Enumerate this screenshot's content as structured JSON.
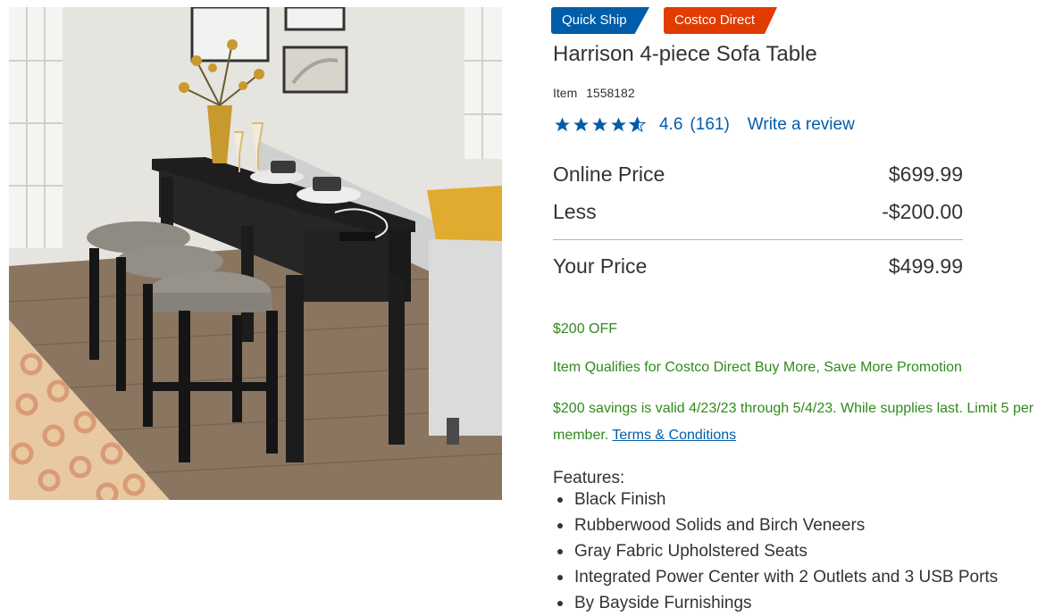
{
  "badges": {
    "quick_ship": "Quick Ship",
    "costco_direct": "Costco Direct"
  },
  "product": {
    "title": "Harrison 4-piece Sofa Table",
    "item_label": "Item",
    "item_number": "1558182",
    "image_icon": "sofa-table-photo"
  },
  "rating": {
    "value": "4.6",
    "stars_fraction": 0.92,
    "count": "(161)",
    "write_review": "Write a review"
  },
  "pricing": {
    "online_label": "Online Price",
    "online_value": "$699.99",
    "less_label": "Less",
    "less_value": "-$200.00",
    "your_label": "Your Price",
    "your_value": "$499.99"
  },
  "promotion": {
    "off": "$200 OFF",
    "qualifies": "Item Qualifies for Costco Direct Buy More, Save More Promotion",
    "valid_text": "$200 savings is valid 4/23/23 through 5/4/23. While supplies last. Limit 5 per member.",
    "terms_link": "Terms & Conditions"
  },
  "features": {
    "label": "Features:",
    "items": [
      "Black Finish",
      "Rubberwood Solids and Birch Veneers",
      "Gray Fabric Upholstered Seats",
      "Integrated Power Center with 2 Outlets and 3 USB Ports",
      "By Bayside Furnishings"
    ]
  },
  "colors": {
    "link_blue": "#005daa",
    "promo_green": "#2e8b1b",
    "direct_orange": "#e03c00",
    "star_blue": "#005daa"
  }
}
